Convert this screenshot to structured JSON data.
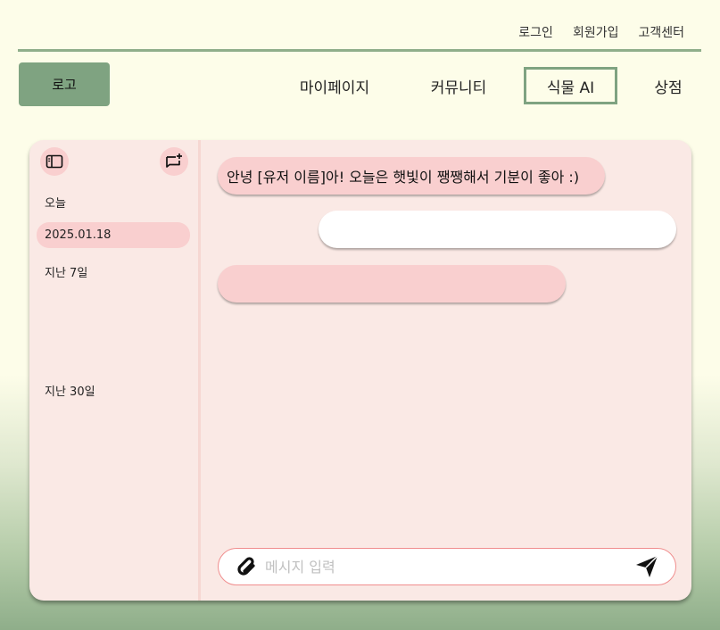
{
  "header": {
    "top_links": [
      "로그인",
      "회원가입",
      "고객센터"
    ],
    "logo": "로고",
    "nav": [
      "마이페이지",
      "커뮤니티",
      "식물 AI",
      "상점"
    ],
    "active_nav": "식물 AI"
  },
  "sidebar": {
    "today_label": "오늘",
    "items": [
      "2025.01.18"
    ],
    "last7_label": "지난 7일",
    "last30_label": "지난 30일"
  },
  "chat": {
    "messages": [
      {
        "role": "bot",
        "text": "안녕 [유저 이름]아! 오늘은 햇빛이 쨍쨍해서 기분이 좋아 :)"
      },
      {
        "role": "user",
        "text": ""
      },
      {
        "role": "bot",
        "text": ""
      }
    ],
    "input_placeholder": "메시지 입력"
  },
  "icons": {
    "sidebar_toggle": "sidebar-toggle-icon",
    "new_chat": "new-chat-icon",
    "attach": "paperclip-icon",
    "send": "send-icon"
  },
  "colors": {
    "accent_green": "#7fa381",
    "card_bg": "#fae9e5",
    "pink": "#f9cfcf",
    "input_border": "#f08e8e"
  }
}
